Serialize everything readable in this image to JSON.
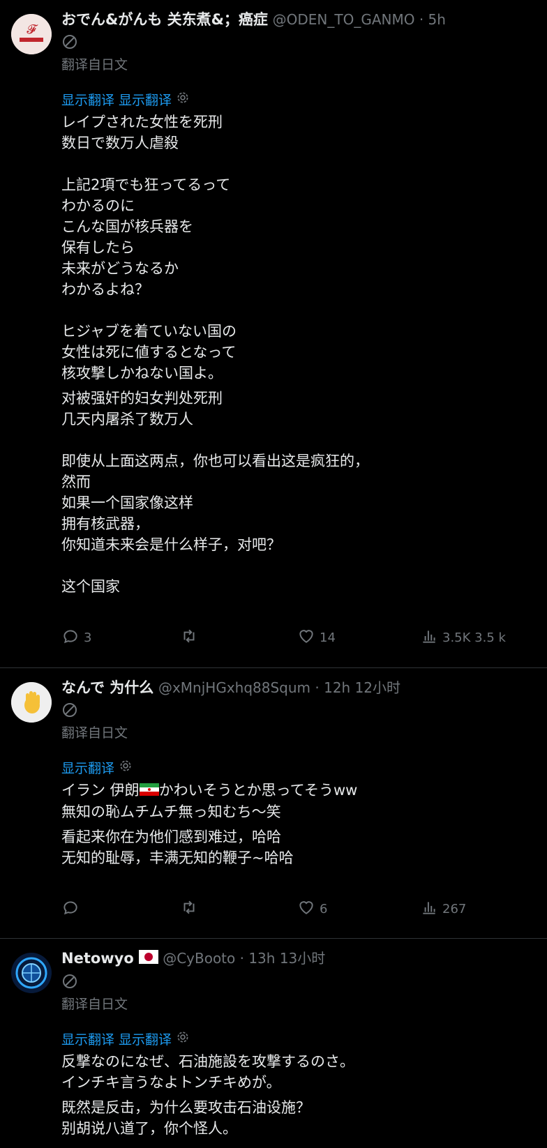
{
  "tweets": [
    {
      "name": "おでん&がんも 关东煮&；癌症",
      "handle": "@ODEN_TO_GANMO · 5h",
      "translated_from": "翻译自日文",
      "show_translation": "显示翻译 显示翻译",
      "original_text": "レイプされた女性を死刑\n数日で数万人虐殺\n\n上記2項でも狂ってるって\nわかるのに\nこんな国が核兵器を\n保有したら\n未来がどうなるか\nわかるよね？\n\nヒジャブを着ていない国の\n女性は死に値するとなって\n核攻撃しかねない国よ。",
      "translated_text": "对被强奸的妇女判处死刑\n几天内屠杀了数万人\n\n即使从上面这两点，你也可以看出这是疯狂的，\n然而\n如果一个国家像这样\n拥有核武器，\n你知道未来会是什么样子，对吧？\n\n这个国家",
      "replies": "3",
      "retweets": "",
      "likes": "14",
      "views": "3.5K 3.5 k"
    },
    {
      "name": "なんで 为什么",
      "handle": "@xMnjHGxhq88Squm · 12h 12小时",
      "translated_from": "翻译自日文",
      "show_translation": "显示翻译",
      "original_text_a": "イラン  伊朗",
      "original_text_b": "かわいそうとか思ってそうww\n無知の恥ムチムチ無っ知むち〜笑",
      "translated_text": "看起来你在为他们感到难过，哈哈\n无知的耻辱，丰满无知的鞭子~哈哈",
      "replies": "",
      "retweets": "",
      "likes": "6",
      "views": "267"
    },
    {
      "name": "Netowyo",
      "handle": "@CyBooto · 13h 13小时",
      "translated_from": "翻译自日文",
      "show_translation": "显示翻译 显示翻译",
      "original_text": "反撃なのになぜ、石油施設を攻撃するのさ。\nインチキ言うなよトンチキめが。",
      "translated_text": "既然是反击，为什么要攻击石油设施？\n别胡说八道了，你个怪人。"
    }
  ],
  "colors": {
    "accent": "#1d9bf0",
    "muted": "#71767b",
    "text": "#e7e9ea",
    "border": "#2f3336"
  },
  "icons": [
    "no-entry-icon",
    "gear-icon",
    "reply-icon",
    "retweet-icon",
    "like-icon",
    "views-icon",
    "waving-hand-icon",
    "iran-flag-icon",
    "japan-flag-icon"
  ]
}
